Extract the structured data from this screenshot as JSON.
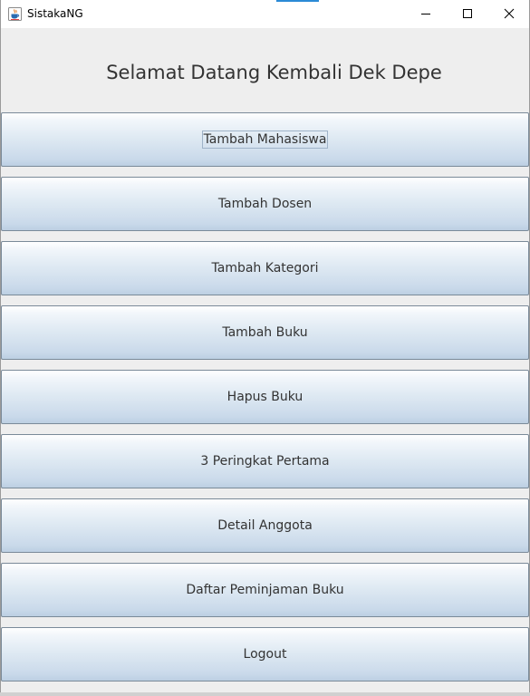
{
  "window": {
    "title": "SistakaNG"
  },
  "header": {
    "welcome_text": "Selamat Datang Kembali Dek Depe"
  },
  "menu": {
    "items": [
      {
        "label": "Tambah Mahasiswa"
      },
      {
        "label": "Tambah Dosen"
      },
      {
        "label": "Tambah Kategori"
      },
      {
        "label": "Tambah Buku"
      },
      {
        "label": "Hapus Buku"
      },
      {
        "label": "3 Peringkat Pertama"
      },
      {
        "label": "Detail Anggota"
      },
      {
        "label": "Daftar Peminjaman Buku"
      },
      {
        "label": "Logout"
      }
    ]
  },
  "colors": {
    "window_bg": "#eeeeee",
    "titlebar_bg": "#ffffff",
    "button_border": "#7a8a99",
    "button_gradient_top": "#ffffff",
    "button_gradient_bottom": "#bccfe2",
    "text": "#333333"
  },
  "icons": {
    "app": "java-cup-icon",
    "minimize": "minimize-icon",
    "maximize": "maximize-icon",
    "close": "close-icon"
  }
}
